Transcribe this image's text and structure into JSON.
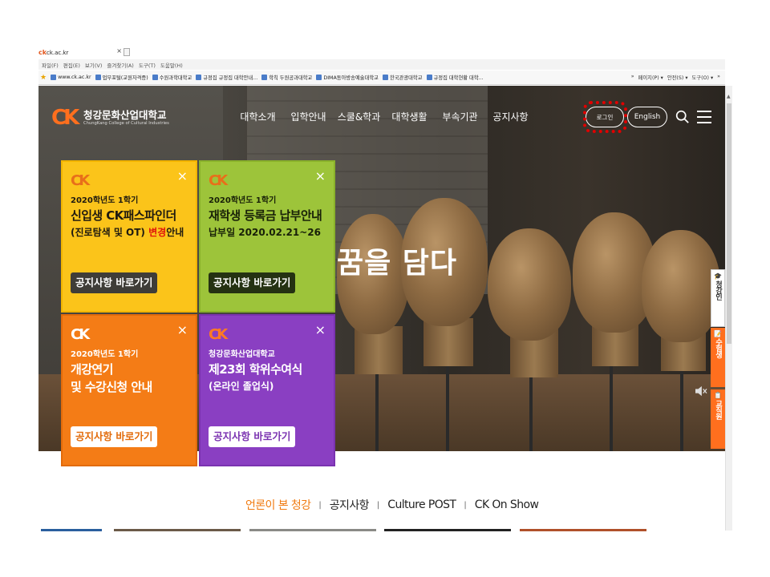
{
  "browser": {
    "tab_title": "ck.ac.kr",
    "tab_close": "×",
    "menu": [
      "파일(F)",
      "편집(E)",
      "보기(V)",
      "즐겨찾기(A)",
      "도구(T)",
      "도움말(H)"
    ],
    "favorites": [
      "www.ck.ac.kr",
      "업무포털(교원자격증)",
      "수원과학대학교",
      "규정집  규정집  대학안내...",
      "학칙  두원공과대학교",
      "DIMA동아방송예술대학교",
      "한국관광대학교",
      "규정집  대학현황  대학..."
    ],
    "tools": [
      "»",
      "페이지(P) ▾",
      "안전(S) ▾",
      "도구(O) ▾",
      "»"
    ]
  },
  "site": {
    "logo_mark": "CK",
    "logo_ko": "청강문화산업대학교",
    "logo_en": "ChungKang College of Cultural Industries",
    "menu": [
      "대학소개",
      "입학안내",
      "스쿨&학과",
      "대학생활",
      "부속기관",
      "공지사항"
    ],
    "login_label": "로그인",
    "english_label": "English",
    "slogan": "꿈을 담다",
    "quick_tabs": [
      {
        "icon": "🎓",
        "label": "청강인"
      },
      {
        "icon": "📝",
        "label": "수험생"
      },
      {
        "icon": "📋",
        "label": "교직원"
      }
    ]
  },
  "popups": [
    {
      "logo": "CK",
      "close": "×",
      "line1": "2020학년도 1학기",
      "line2": "신입생 CK패스파인더",
      "line3a": "(진로탐색 및 OT) ",
      "line3b": "변경",
      "line3c": "안내",
      "button": "공지사항 바로가기"
    },
    {
      "logo": "CK",
      "close": "×",
      "line1": "2020학년도 1학기",
      "line2": "재학생 등록금 납부안내",
      "line3a": "납부일 2020.02.21~26",
      "line3b": "",
      "line3c": "",
      "button": "공지사항 바로가기"
    },
    {
      "logo": "CK",
      "close": "×",
      "line1": "2020학년도 1학기",
      "line2": "개강연기",
      "line3a": "및 수강신청 안내",
      "line3b": "",
      "line3c": "",
      "button": "공지사항 바로가기"
    },
    {
      "logo": "CK",
      "close": "×",
      "line1": "청강문화산업대학교",
      "line2": "제23회 학위수여식",
      "line3a": "(온라인 졸업식)",
      "line3b": "",
      "line3c": "",
      "button": "공지사항 바로가기"
    }
  ],
  "news_tabs": [
    "언론이 본 청강",
    "공지사항",
    "Culture POST",
    "CK On Show"
  ],
  "news_active": 0,
  "colors": {
    "brand_orange": "#ff6f1e",
    "login_highlight": "#e00000"
  }
}
